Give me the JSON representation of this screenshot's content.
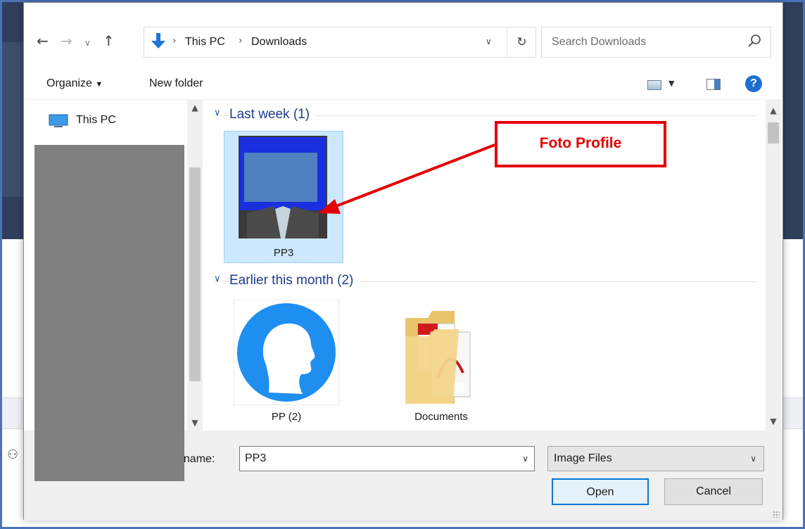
{
  "dialog": {
    "breadcrumb": [
      "This PC",
      "Downloads"
    ],
    "search_placeholder": "Search Downloads",
    "toolbar": {
      "organize_label": "Organize",
      "new_folder_label": "New folder",
      "help_label": "?"
    }
  },
  "nav_pane": {
    "items": [
      {
        "label": "This PC",
        "icon": "computer-icon"
      }
    ]
  },
  "file_groups": [
    {
      "label": "Last week (1)",
      "files": [
        {
          "name": "PP3",
          "type": "image",
          "selected": true
        }
      ]
    },
    {
      "label": "Earlier this month (2)",
      "files": [
        {
          "name": "PP (2)",
          "type": "image"
        },
        {
          "name": "Documents",
          "type": "folder"
        }
      ]
    }
  ],
  "bottom": {
    "file_name_label": "le name:",
    "file_name_value": "PP3",
    "file_type_value": "Image Files",
    "open_label": "Open",
    "cancel_label": "Cancel"
  },
  "annotation": {
    "label": "Foto Profile",
    "color": "#e50000"
  },
  "colors": {
    "selection": "#cce8ff",
    "accent": "#0078d7",
    "group_header": "#1e3c8c",
    "redaction": "#808080"
  },
  "background_app": {
    "user_icon": "user-icon"
  }
}
